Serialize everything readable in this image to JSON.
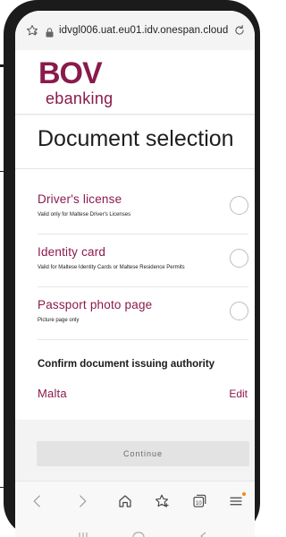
{
  "browser": {
    "url": "idvgl006.uat.eu01.idv.onespan.cloud"
  },
  "brand": {
    "logo_text": "BOV",
    "sub_text": "ebanking",
    "color": "#8a1a4c"
  },
  "page": {
    "title": "Document selection"
  },
  "documents": [
    {
      "label": "Driver's license",
      "description": "Valid only for Maltese Driver's Licenses",
      "selected": false
    },
    {
      "label": "Identity card",
      "description": "Valid for Maltese Identity Cards or Maltese Residence Permits",
      "selected": false
    },
    {
      "label": "Passport photo page",
      "description": "Picture page only",
      "selected": false
    }
  ],
  "authority": {
    "heading": "Confirm document issuing authority",
    "value": "Malta",
    "edit_label": "Edit"
  },
  "actions": {
    "continue_label": "Continue"
  },
  "icons": {
    "bookmark": "star-outline-icon",
    "lock": "lock-icon",
    "reload": "reload-icon",
    "back": "chevron-left-icon",
    "forward": "chevron-right-icon",
    "home": "home-icon",
    "favorites": "star-add-icon",
    "tabs": "tabs-icon",
    "menu": "menu-icon",
    "notification_color": "#f08a1a"
  }
}
